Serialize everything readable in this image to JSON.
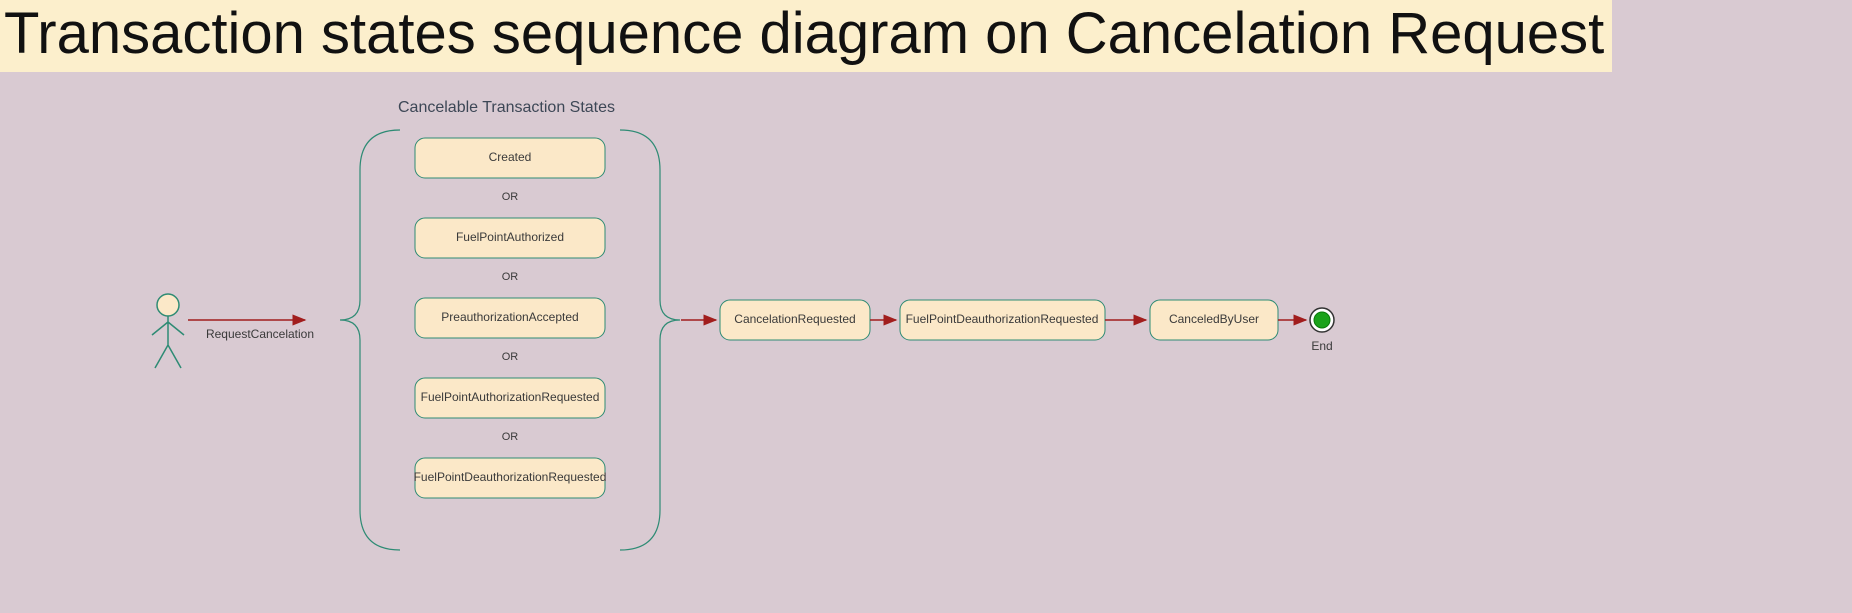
{
  "title": "Transaction states sequence diagram on Cancelation Request",
  "actor": {
    "edge_label": "RequestCancelation"
  },
  "group": {
    "title": "Cancelable Transaction States",
    "or_sep": "OR",
    "states": [
      "Created",
      "FuelPointAuthorized",
      "PreauthorizationAccepted",
      "FuelPointAuthorizationRequested",
      "FuelPointDeauthorizationRequested"
    ]
  },
  "flow": [
    "CancelationRequested",
    "FuelPointDeauthorizationRequested",
    "CanceledByUser"
  ],
  "end_label": "End"
}
